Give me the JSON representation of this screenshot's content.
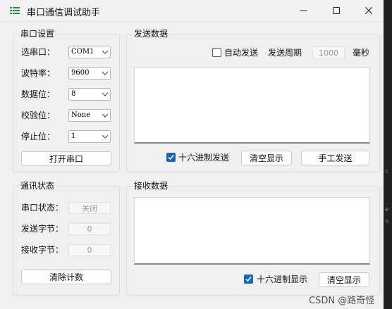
{
  "window": {
    "title": "串口通信调试助手"
  },
  "serial_settings": {
    "title": "串口设置",
    "port_label": "选串口：",
    "port_value": "COM1",
    "baud_label": "波特率：",
    "baud_value": "9600",
    "databits_label": "数据位：",
    "databits_value": "8",
    "parity_label": "校验位：",
    "parity_value": "None",
    "stopbits_label": "停止位：",
    "stopbits_value": "1",
    "open_button": "打开串口"
  },
  "comm_status": {
    "title": "通讯状态",
    "port_status_label": "串口状态：",
    "port_status_value": "关闭",
    "sent_bytes_label": "发送字节：",
    "sent_bytes_value": "0",
    "recv_bytes_label": "接收字节：",
    "recv_bytes_value": "0",
    "clear_count_button": "清除计数"
  },
  "send_data": {
    "title": "发送数据",
    "auto_send_label": "自动发送",
    "auto_send_checked": false,
    "period_label": "发送周期",
    "period_value": "1000",
    "period_unit": "毫秒",
    "hex_send_label": "十六进制发送",
    "hex_send_checked": true,
    "clear_display_button": "清空显示",
    "manual_send_button": "手工发送"
  },
  "recv_data": {
    "title": "接收数据",
    "hex_display_label": "十六进制显示",
    "hex_display_checked": true,
    "clear_display_button": "清空显示"
  },
  "watermark": "CSDN @路奇怪",
  "background_code": [
    "c",
    "e",
    "n"
  ],
  "colors": {
    "accent": "#1f65b6",
    "window_bg": "#f0f0f0",
    "desktop_bg": "#202020"
  }
}
